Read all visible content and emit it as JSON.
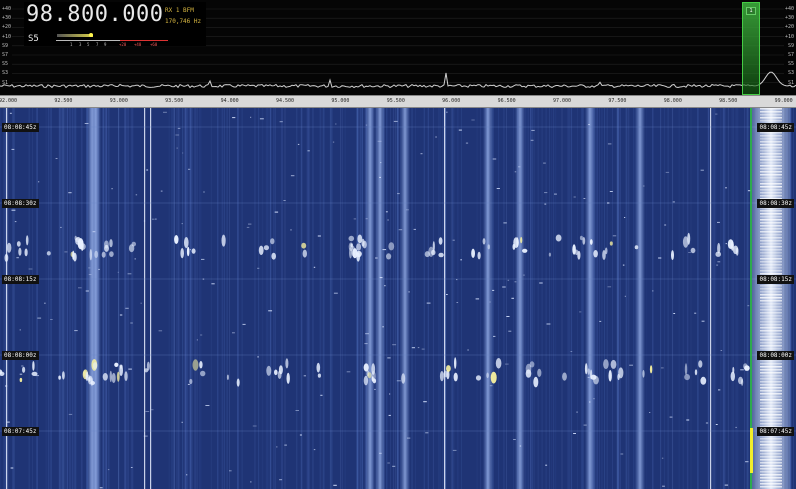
{
  "receiver": {
    "frequency": "98.800.000",
    "rx_label": "RX 1  BFM",
    "rx_freq": "170,746 Hz",
    "smeter_label": "S5",
    "smeter_ticks": [
      "1",
      "3",
      "5",
      "7",
      "9",
      "+20",
      "+40",
      "+60"
    ]
  },
  "spectrum": {
    "db_scale": [
      "+40",
      "+30",
      "+20",
      "+10",
      "S9",
      "S7",
      "S5",
      "S3",
      "S1"
    ],
    "vfo_marker_label": "1"
  },
  "axis": {
    "ticks": [
      "92.000",
      "92.500",
      "93.000",
      "93.500",
      "94.000",
      "94.500",
      "95.000",
      "95.500",
      "96.000",
      "96.500",
      "97.000",
      "97.500",
      "98.000",
      "98.500",
      "99.000"
    ]
  },
  "waterfall": {
    "timestamps": [
      "08:08:45z",
      "08:08:30z",
      "08:08:15z",
      "08:08:00z",
      "08:07:45z"
    ]
  },
  "colors": {
    "waterfall_bg": "#1f3475",
    "signal": "#cfe0ff",
    "vfo": "#3aa03a"
  }
}
